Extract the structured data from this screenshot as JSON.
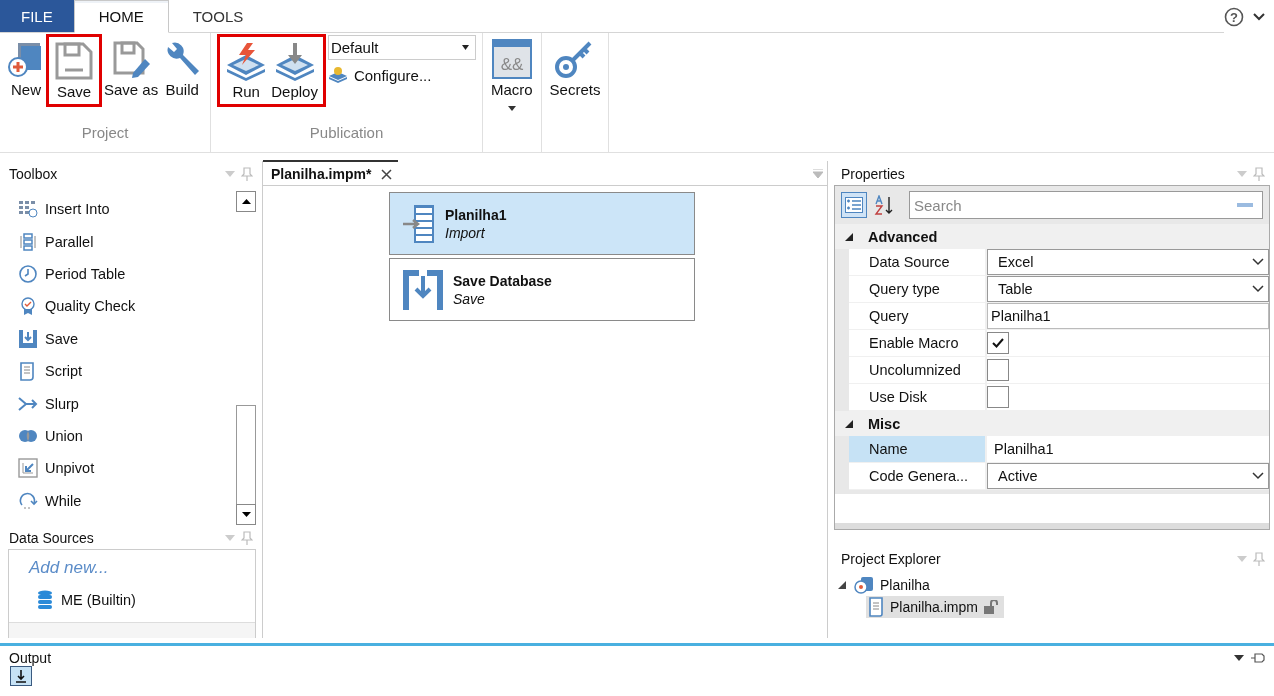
{
  "tabs": [
    {
      "label": "FILE",
      "kind": "file",
      "selected": false
    },
    {
      "label": "HOME",
      "kind": "tab",
      "selected": true
    },
    {
      "label": "TOOLS",
      "kind": "tab",
      "selected": false
    }
  ],
  "ribbon": {
    "groups": [
      {
        "label": "Project",
        "items": [
          {
            "kind": "button",
            "label": "New"
          },
          {
            "kind": "highlight",
            "buttons": [
              {
                "label": "Save"
              }
            ]
          },
          {
            "kind": "button",
            "label": "Save as"
          },
          {
            "kind": "button",
            "label": "Build"
          }
        ]
      },
      {
        "label": "Publication",
        "items": [
          {
            "kind": "highlight",
            "buttons": [
              {
                "label": "Run"
              },
              {
                "label": "Deploy"
              }
            ]
          },
          {
            "kind": "stack",
            "dropdown": "Default",
            "link": "Configure..."
          }
        ]
      },
      {
        "items": [
          {
            "kind": "menu",
            "label": "Macro",
            "icon_text": "&&"
          }
        ]
      },
      {
        "items": [
          {
            "kind": "button",
            "label": "Secrets"
          }
        ]
      }
    ]
  },
  "help": "?",
  "toolbox": {
    "title": "Toolbox",
    "items": [
      "Insert Into",
      "Parallel",
      "Period Table",
      "Quality Check",
      "Save",
      "Script",
      "Slurp",
      "Union",
      "Unpivot",
      "While"
    ]
  },
  "data_sources": {
    "title": "Data Sources",
    "add": "Add new...",
    "items": [
      "ME (Builtin)"
    ]
  },
  "document": {
    "tab": "Planilha.impm*",
    "nodes": [
      {
        "name": "Planilha1",
        "type": "Import",
        "selected": true
      },
      {
        "name": "Save Database",
        "type": "Save",
        "selected": false
      }
    ]
  },
  "properties": {
    "title": "Properties",
    "search": {
      "placeholder": "Search"
    },
    "categories": [
      {
        "name": "Advanced",
        "expanded": true,
        "rows": [
          {
            "label": "Data Source",
            "kind": "dropdown",
            "value": "Excel",
            "selected": false
          },
          {
            "label": "Query type",
            "kind": "dropdown",
            "value": "Table",
            "selected": false
          },
          {
            "label": "Query",
            "kind": "text",
            "value": "Planilha1",
            "selected": false
          },
          {
            "label": "Enable Macro",
            "kind": "checkbox",
            "checked": true,
            "selected": false
          },
          {
            "label": "Uncolumnized",
            "kind": "checkbox",
            "checked": false,
            "selected": false
          },
          {
            "label": "Use Disk",
            "kind": "checkbox",
            "checked": false,
            "selected": false
          }
        ]
      },
      {
        "name": "Misc",
        "expanded": true,
        "rows": [
          {
            "label": "Name",
            "kind": "plain",
            "value": "Planilha1",
            "selected": true
          },
          {
            "label": "Code Genera...",
            "kind": "dropdown",
            "value": "Active",
            "selected": false
          }
        ]
      }
    ]
  },
  "project_explorer": {
    "title": "Project Explorer",
    "tree": [
      {
        "label": "Planilha",
        "expanded": true,
        "selected": false,
        "children": [
          {
            "label": "Planilha.impm",
            "selected": true
          }
        ]
      }
    ]
  },
  "output": {
    "title": "Output"
  }
}
